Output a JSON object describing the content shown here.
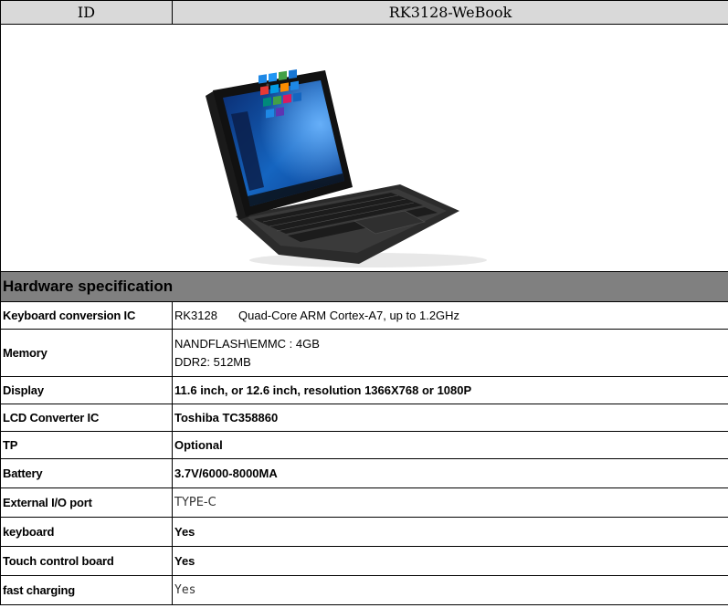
{
  "header": {
    "id_label": "ID",
    "model": "RK3128-WeBook"
  },
  "image": {
    "icon": "tablet-laptop-photo"
  },
  "section_title": "Hardware specification",
  "specs": {
    "keyboard_ic": {
      "label": "Keyboard conversion IC",
      "chip": "RK3128",
      "detail": "Quad-Core ARM Cortex-A7, up to 1.2GHz"
    },
    "memory": {
      "label": "Memory",
      "line1": "NANDFLASH\\EMMC : 4GB",
      "line2": "DDR2:  512MB"
    },
    "display": {
      "label": "Display",
      "value": "11.6 inch, or 12.6 inch, resolution 1366X768 or 1080P"
    },
    "lcd": {
      "label": "LCD Converter IC",
      "value": "Toshiba TC358860"
    },
    "tp": {
      "label": "TP",
      "value": "Optional"
    },
    "battery": {
      "label": "Battery",
      "value": "3.7V/6000-8000MA"
    },
    "io": {
      "label": "External I/O port",
      "value": "TYPE-C"
    },
    "keyboard": {
      "label": "keyboard",
      "value": "Yes"
    },
    "touch": {
      "label": "Touch control board",
      "value": "Yes"
    },
    "fast_charging": {
      "label": "fast charging",
      "value": "Yes"
    }
  }
}
